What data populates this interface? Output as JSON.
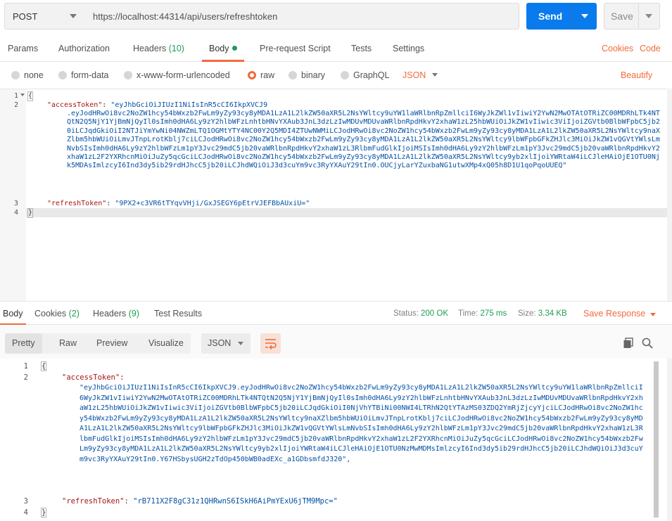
{
  "request": {
    "method": "POST",
    "url": "https://localhost:44314/api/users/refreshtoken",
    "send_label": "Send",
    "save_label": "Save"
  },
  "request_tabs": {
    "params": "Params",
    "authorization": "Authorization",
    "headers": "Headers",
    "headers_count": "(10)",
    "body": "Body",
    "prerequest": "Pre-request Script",
    "tests": "Tests",
    "settings": "Settings",
    "cookies": "Cookies",
    "code": "Code"
  },
  "body_types": {
    "none": "none",
    "form_data": "form-data",
    "urlencoded": "x-www-form-urlencoded",
    "raw": "raw",
    "binary": "binary",
    "graphql": "GraphQL",
    "format": "JSON",
    "beautify": "Beautify",
    "selected": "raw"
  },
  "request_body": {
    "line_numbers": [
      "1",
      "2",
      "3",
      "4"
    ],
    "open_brace": "{",
    "close_brace": "}",
    "access_key": "\"accessToken\"",
    "access_value_first": "\"eyJhbGciOiJIUzI1NiIsInR5cCI6IkpXVCJ9",
    "access_value_rest": ".eyJodHRwOi8vc2NoZW1hcy54bWxzb2FwLm9yZy93cy8yMDA1LzA1L2lkZW50aXR5L2NsYWltcy9uYW1laWRlbnRpZmllciI6WyJkZWl1vIiwiY2YwN2MwOTAtOTRiZC00MDRhLTk4NTQtN2Q5NjY1YjBmNjQyIl0sImh0dHA6Ly9zY2hlbWFzLnhtbHNvYXAub3JnL3dzLzIwMDUvMDUvaWRlbnRpdHkvY2xhaW1zL25hbWUiOiJkZW1vIiwic3ViIjoiZGVtb0BlbWFpbC5jb20iLCJqdGkiOiI2NTJiYmYwNi04NWZmLTQ1OGMtYTY4NC00Y2Q5MDI4ZTUwNWMiLCJodHRwOi8vc2NoZW1hcy54bWxzb2FwLm9yZy93cy8yMDA1LzA1L2lkZW50aXR5L2NsYWltcy9naXZlbm5hbWUiOiLmvJTnpLrotKblj7ciLCJodHRwOi8vc2NoZW1hcy54bWxzb2FwLm9yZy93cy8yMDA1LzA1L2lkZW50aXR5L2NsYWltcy9lbWFpbGFkZHJlc3MiOiJkZW1vQGVtYWlsLmNvbSIsImh0dHA6Ly9zY2hlbWFzLm1pY3Jvc29mdC5jb20vaWRlbnRpdHkvY2xhaW1zL3RlbmFudGlkIjoiMSIsImh0dHA6Ly9zY2hlbWFzLm1pY3Jvc29mdC5jb20vaWRlbnRpdHkvY2xhaW1zL2F2YXRhcnMiOiJuZy5qcGciLCJodHRwOi8vc2NoZW1hcy54bWxzb2FwLm9yZy93cy8yMDA1LzA1L2lkZW50aXR5L2NsYWltcy9yb2xlIjoiYWRtaW4iLCJleHAiOjE1OTU0Njk5MDAsImlzcyI6Ind3dy5ib29rdHJhcC5jb20iLCJhdWQiOiJ3d3cuYm9vc3RyYXAuY29tIn0.OUCjyLarYZuxbaNG1utwXMp4xQ05h8D1U1qoPqoUUEQ\"",
    "refresh_key": "\"refreshToken\"",
    "refresh_value": "\"9PX2+c3VR6tTYqvVHji/GxJSEGY6pEtrVJEFBbAUxiU=\""
  },
  "response_tabs": {
    "body": "Body",
    "cookies": "Cookies",
    "cookies_count": "(2)",
    "headers": "Headers",
    "headers_count": "(9)",
    "test_results": "Test Results",
    "status_label": "Status:",
    "status_value": "200 OK",
    "time_label": "Time:",
    "time_value": "275 ms",
    "size_label": "Size:",
    "size_value": "3.34 KB",
    "save_response": "Save Response"
  },
  "response_toolbar": {
    "pretty": "Pretty",
    "raw": "Raw",
    "preview": "Preview",
    "visualize": "Visualize",
    "format": "JSON"
  },
  "response_body": {
    "line_numbers": [
      "1",
      "2",
      "3",
      "4"
    ],
    "open_brace": "{",
    "close_brace": "}",
    "access_key": "\"accessToken\":",
    "access_value": "\"eyJhbGciOiJIUzI1NiIsInR5cCI6IkpXVCJ9.eyJodHRwOi8vc2NoZW1hcy54bWxzb2FwLm9yZy93cy8yMDA1LzA1L2lkZW50aXR5L2NsYWltcy9uYW1laWRlbnRpZmllciI6WyJkZW1vIiwiY2YwN2MwOTAtOTRiZC00MDRhLTk4NTQtN2Q5NjY1YjBmNjQyIl0sImh0dHA6Ly9zY2hlbWFzLnhtbHNvYXAub3JnL3dzLzIwMDUvMDUvaWRlbnRpdHkvY2xhaW1zL25hbWUiOiJkZW1vIiwic3ViIjoiZGVtb0BlbWFpbC5jb20iLCJqdGkiOiI0NjVhYTBiNi00NWI4LTRhN2QtYTAzMS03ZDQ2YmRjZjcyYjciLCJodHRwOi8vc2NoZW1hcy54bWxzb2FwLm9yZy93cy8yMDA1LzA1L2lkZW50aXR5L2NsYWltcy9naXZlbm5hbWUiOiLmvJTnpLrotKblj7ciLCJodHRwOi8vc2NoZW1hcy54bWxzb2FwLm9yZy93cy8yMDA1LzA1L2lkZW50aXR5L2NsYWltcy9lbWFpbGFkZHJlc3MiOiJkZW1vQGVtYWlsLmNvbSIsImh0dHA6Ly9zY2hlbWFzLm1pY3Jvc29mdC5jb20vaWRlbnRpdHkvY2xhaW1zL3RlbmFudGlkIjoiMSIsImh0dHA6Ly9zY2hlbWFzLm1pY3Jvc29mdC5jb20vaWRlbnRpdHkvY2xhaW1zL2F2YXRhcnMiOiJuZy5qcGciLCJodHRwOi8vc2NoZW1hcy54bWxzb2FwLm9yZy93cy8yMDA1LzA1L2lkZW50aXR5L2NsYWltcy9yb2xlIjoiYWRtaW4iLCJleHAiOjE1OTU0NzMwMDMsImlzcyI6Ind3dy5ib29rdHJhcC5jb20iLCJhdWQiOiJ3d3cuYm9vc3RyYXAuY29tIn0.Y67HSbysUGH2zTdOp450bWB0adEXc_a1GDbsmfdJ320\",",
    "refresh_key": "\"refreshToken\":",
    "refresh_value": "\"rB711X2F8gC31z1QHRwnS6ISkH6AiPmYExU6jTM9Mpc=\""
  },
  "icons": {
    "copy": "copy-icon",
    "search": "search-icon",
    "wrap": "wrap-lines-icon"
  },
  "colors": {
    "accent": "#f26b3a",
    "send": "#097bed",
    "success": "#1f9d55",
    "string": "#0451a5",
    "key": "#a31515"
  }
}
